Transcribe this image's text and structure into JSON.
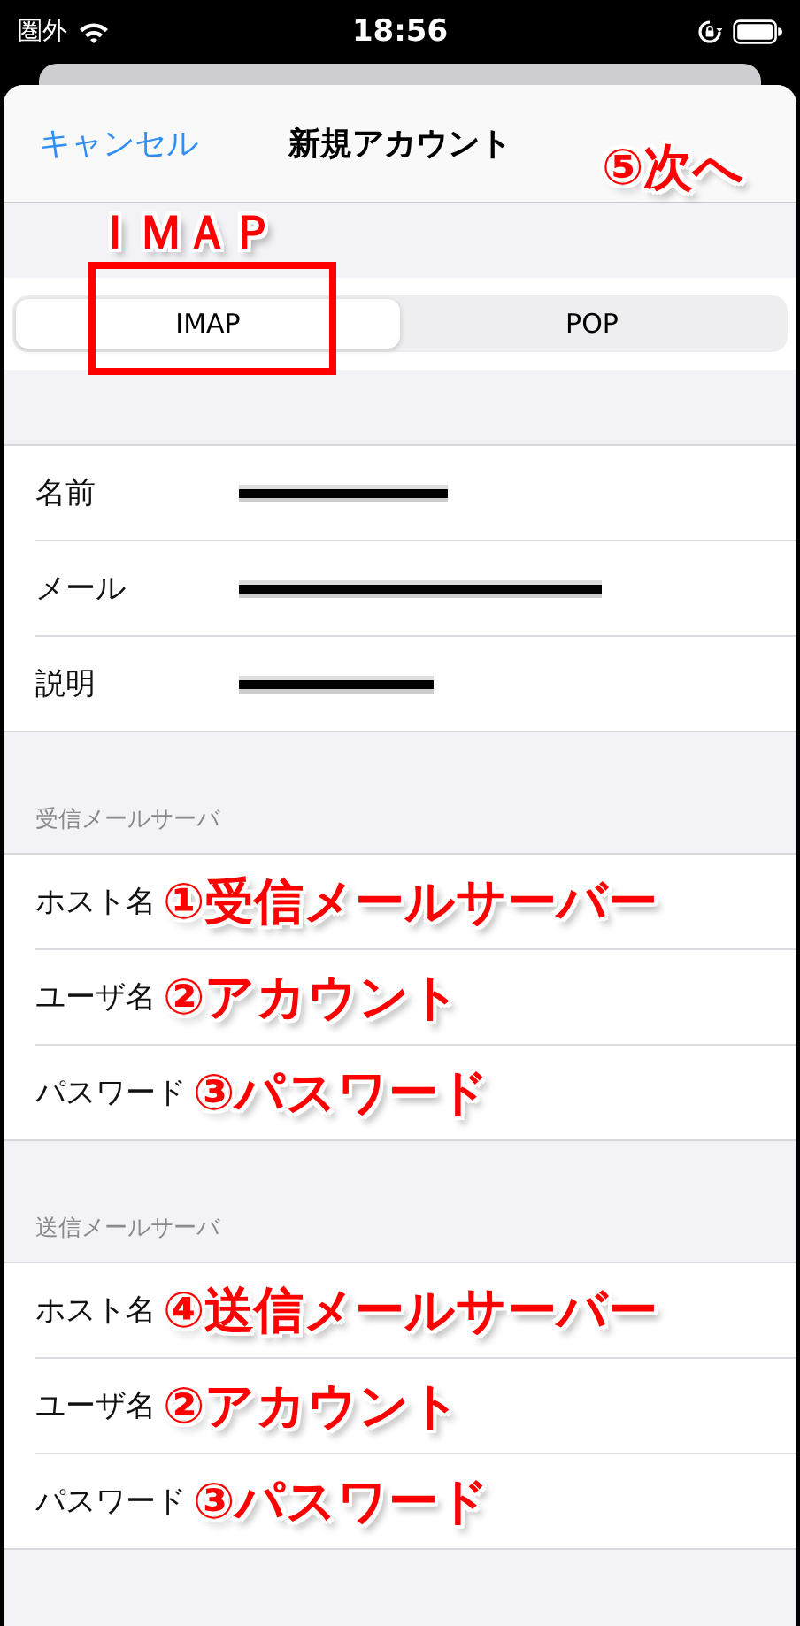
{
  "status_bar": {
    "carrier": "圏外",
    "time": "18:56"
  },
  "nav": {
    "cancel": "キャンセル",
    "title": "新規アカウント"
  },
  "segments": [
    {
      "label": "IMAP",
      "selected": true
    },
    {
      "label": "POP",
      "selected": false
    }
  ],
  "account_fields": [
    {
      "label": "名前",
      "redacted": true
    },
    {
      "label": "メール",
      "redacted": true
    },
    {
      "label": "説明",
      "redacted": true
    }
  ],
  "server_groups": [
    {
      "header": "受信メールサーバ",
      "fields": [
        {
          "label": "ホスト名",
          "note": "①受信メールサーバー"
        },
        {
          "label": "ユーザ名",
          "note": "②アカウント"
        },
        {
          "label": "パスワード",
          "note": "③パスワード"
        }
      ]
    },
    {
      "header": "送信メールサーバ",
      "fields": [
        {
          "label": "ホスト名",
          "note": "④送信メールサーバー"
        },
        {
          "label": "ユーザ名",
          "note": "②アカウント"
        },
        {
          "label": "パスワード",
          "note": "③パスワード"
        }
      ]
    }
  ],
  "annotations": {
    "next": "⑤次へ",
    "protocol": "ＩＭＡＰ"
  }
}
